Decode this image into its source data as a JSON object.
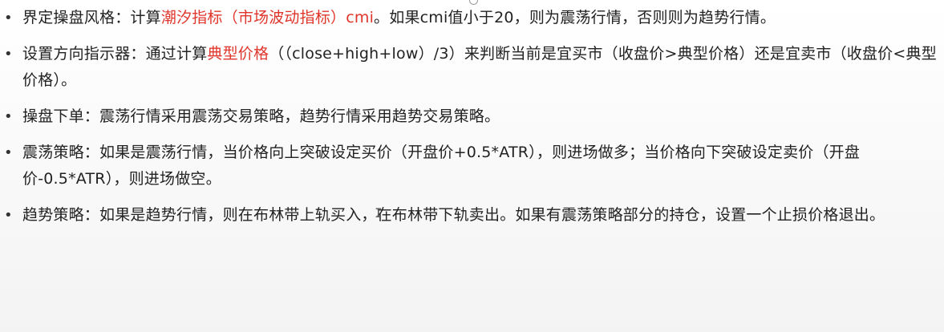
{
  "bullet_symbol": "•",
  "highlight_color": "#e0352b",
  "cursor_glyph": "I",
  "items": [
    {
      "before": "界定操盘风格：计算",
      "highlight": "潮汐指标（市场波动指标）cmi",
      "after": "。如果cmi值小于20，则为震荡行情，否则则为趋势行情。"
    },
    {
      "before": "设置方向指示器：通过计算",
      "highlight": "典型价格",
      "after": "（（close+high+low）/3）来判断当前是宜买市（收盘价>典型价格）还是宜卖市（收盘价<典型价格）。"
    },
    {
      "before": "操盘下单：震荡行情采用震荡交易策略，趋势行情采用趋势交易策略。",
      "highlight": "",
      "after": ""
    },
    {
      "before": "震荡策略：如果是震荡行情，当价格向上突破设定买价（开盘价+0.5*ATR），则进场做多；当价格向下突破设定卖价（开盘价-0.5*ATR），则进场做空。",
      "highlight": "",
      "after": ""
    },
    {
      "before": "趋势策略：如果是趋势行情，则在布林带上轨买入，在布林带下轨卖出。如果有震荡策略部分的持仓，设置一个止损价格退出。",
      "highlight": "",
      "after": ""
    }
  ]
}
